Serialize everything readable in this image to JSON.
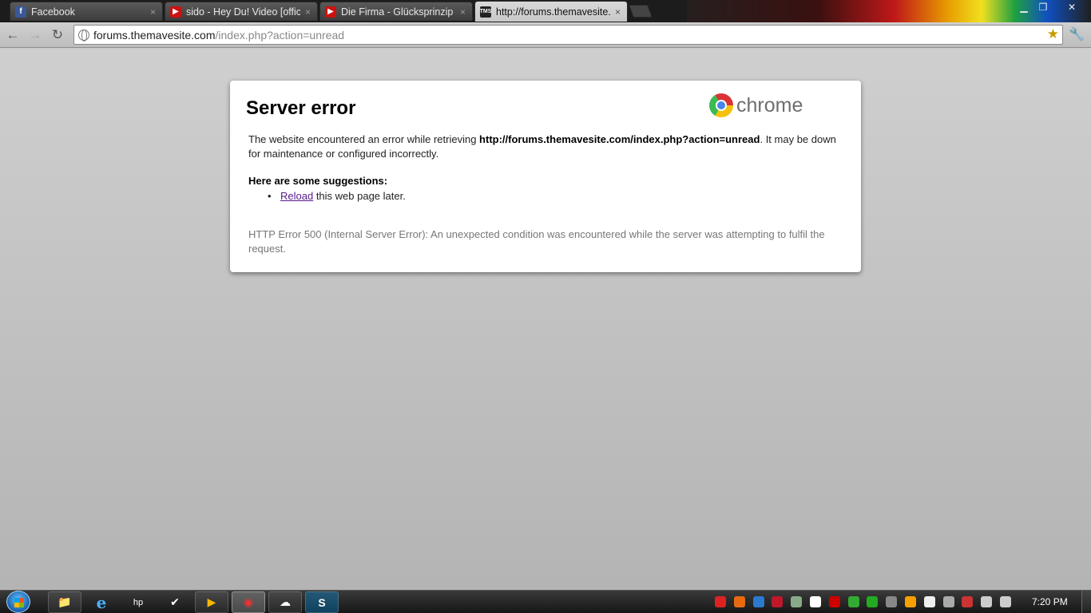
{
  "tabs": [
    {
      "label": "Facebook",
      "favicon": "facebook-icon",
      "active": false
    },
    {
      "label": "sido - Hey Du! Video [officia",
      "favicon": "youtube-icon",
      "active": false
    },
    {
      "label": "Die Firma - Glücksprinzip (C",
      "favicon": "youtube-icon",
      "active": false
    },
    {
      "label": "http://forums.themavesite.c",
      "favicon": "tms-icon",
      "active": true
    }
  ],
  "tab_close_glyph": "×",
  "favicon_text": {
    "fb": "f",
    "yt": "▶",
    "tms": "TMS"
  },
  "window_controls": {
    "minimize": "▁",
    "restore": "❐",
    "close": "✕"
  },
  "toolbar": {
    "back": "←",
    "forward": "→",
    "reload": "↻",
    "url_host": "forums.themavesite.com",
    "url_path": "/index.php?action=unread",
    "star": "★",
    "wrench": "🔧"
  },
  "error_page": {
    "title": "Server error",
    "logo_text": "chrome",
    "message_prefix": "The website encountered an error while retrieving ",
    "message_url": "http://forums.themavesite.com/index.php?action=unread",
    "message_suffix": ". It may be down for maintenance or configured incorrectly.",
    "suggestions_title": "Here are some suggestions:",
    "suggestion_bullet": "•",
    "suggestion_link": "Reload",
    "suggestion_rest": " this web page later.",
    "detail": "HTTP Error 500 (Internal Server Error): An unexpected condition was encountered while the server was attempting to fulfil the request."
  },
  "taskbar": {
    "clock": "7:20 PM",
    "items": [
      {
        "name": "explorer",
        "glyph": "📁"
      },
      {
        "name": "internet-explorer",
        "glyph": "e"
      },
      {
        "name": "hp",
        "glyph": "hp"
      },
      {
        "name": "checkmark-app",
        "glyph": "✔"
      },
      {
        "name": "media-player",
        "glyph": "▶"
      },
      {
        "name": "chrome",
        "glyph": "◉"
      },
      {
        "name": "photo-app",
        "glyph": "☁"
      },
      {
        "name": "skype",
        "glyph": "S"
      }
    ],
    "tray_colors": [
      "#d22",
      "#e86a10",
      "#2a7ad0",
      "#c0182a",
      "#8a8",
      "#fff",
      "#c00",
      "#3a3",
      "#2a2",
      "#888",
      "#f7a000",
      "#eee",
      "#aaa",
      "#c33",
      "#ccc",
      "#ccc"
    ]
  },
  "colors": {
    "link_visited": "#551a8b",
    "detail_text": "#777777",
    "page_bg": "#c9c9c9"
  }
}
